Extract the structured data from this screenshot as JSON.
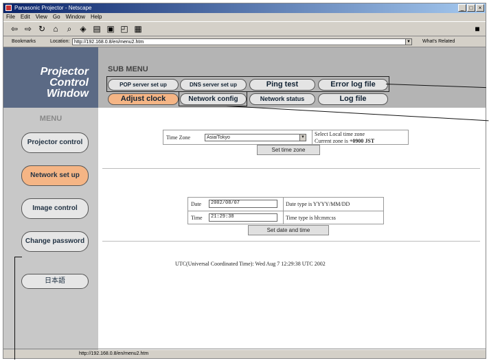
{
  "window": {
    "title": "Panasonic Projector - Netscape"
  },
  "menubar": [
    "File",
    "Edit",
    "View",
    "Go",
    "Window",
    "Help"
  ],
  "toolbar_icons": [
    "back-icon",
    "forward-icon",
    "reload-icon",
    "home-icon",
    "search-icon",
    "netscape-icon",
    "print-icon",
    "security-icon",
    "shop-icon",
    "stop-icon"
  ],
  "location": {
    "bookmarks_label": "Bookmarks",
    "label": "Location:",
    "url": "http://192.168.0.8/en/menu2.htm",
    "whats_related": "What's Related"
  },
  "logo": {
    "line1": "Projector",
    "line2": "Control",
    "line3": "Window"
  },
  "submenu": {
    "title": "SUB MENU",
    "row1": [
      "POP server set up",
      "DNS server set up",
      "Ping test",
      "Error log file"
    ],
    "row2": [
      "Adjust clock",
      "Network config",
      "Network status",
      "Log file"
    ],
    "active": "Adjust clock"
  },
  "menu": {
    "title": "MENU",
    "items": [
      "Projector control",
      "Network set up",
      "Image control",
      "Change password",
      "日本語"
    ],
    "active": "Network set up"
  },
  "timezone": {
    "label": "Time Zone",
    "value": "Asia/Tokyo",
    "note1": "Select Local time zone",
    "note2_prefix": "Current zone is ",
    "note2_value": "+0900 JST",
    "button": "Set time zone"
  },
  "datetime": {
    "date_label": "Date",
    "date_value": "2002/08/07",
    "date_hint": "Date type is YYYY/MM/DD",
    "time_label": "Time",
    "time_value": "21:29:38",
    "time_hint": "Time type is hh:mm:ss",
    "button": "Set date and time"
  },
  "utc": "UTC(Universal Coordinated Time): Wed Aug 7 12:29:38 UTC 2002",
  "statusbar": "http://192.168.0.8/en/menu2.htm"
}
